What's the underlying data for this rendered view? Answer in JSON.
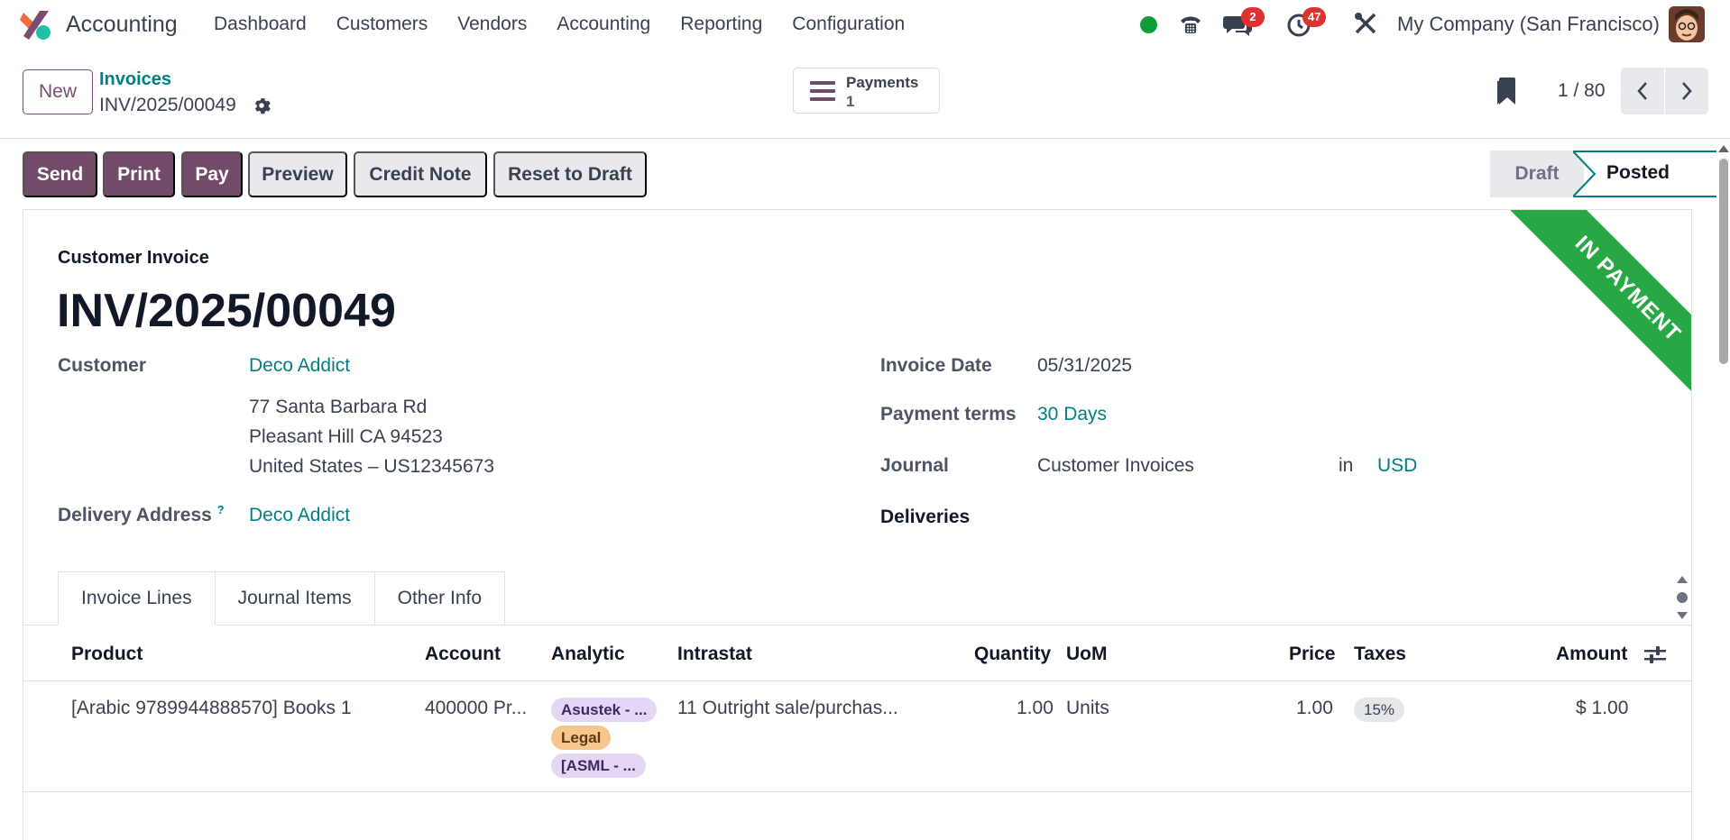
{
  "app": {
    "name": "Accounting",
    "menu": [
      "Dashboard",
      "Customers",
      "Vendors",
      "Accounting",
      "Reporting",
      "Configuration"
    ],
    "company": "My Company (San Francisco)",
    "messages_badge": "2",
    "activities_badge": "47",
    "brand_color": "#714b67",
    "link_color": "#017e84"
  },
  "control_panel": {
    "new_label": "New",
    "breadcrumb_parent": "Invoices",
    "breadcrumb_current": "INV/2025/00049",
    "payments_label": "Payments",
    "payments_count": "1",
    "pager_value": "1 / 80"
  },
  "actions": {
    "send": "Send",
    "print": "Print",
    "pay": "Pay",
    "preview": "Preview",
    "credit_note": "Credit Note",
    "reset_to_draft": "Reset to Draft"
  },
  "status": {
    "draft": "Draft",
    "posted": "Posted"
  },
  "invoice": {
    "ribbon": "IN PAYMENT",
    "type_label": "Customer Invoice",
    "name": "INV/2025/00049",
    "customer_label": "Customer",
    "customer": "Deco Addict",
    "address_line1": "77 Santa Barbara Rd",
    "address_line2": "Pleasant Hill CA 94523",
    "address_line3": "United States – US12345673",
    "delivery_label": "Delivery Address",
    "delivery_help": "?",
    "delivery": "Deco Addict",
    "invoice_date_label": "Invoice Date",
    "invoice_date": "05/31/2025",
    "payment_terms_label": "Payment terms",
    "payment_terms": "30 Days",
    "journal_label": "Journal",
    "journal": "Customer Invoices",
    "journal_in": "in",
    "currency": "USD",
    "deliveries_label": "Deliveries"
  },
  "tabs": [
    "Invoice Lines",
    "Journal Items",
    "Other Info"
  ],
  "lines": {
    "headers": {
      "product": "Product",
      "account": "Account",
      "analytic": "Analytic",
      "intrastat": "Intrastat",
      "quantity": "Quantity",
      "uom": "UoM",
      "price": "Price",
      "taxes": "Taxes",
      "amount": "Amount"
    },
    "rows": [
      {
        "product": "[Arabic 9789944888570] Books 1",
        "account": "400000 Pr...",
        "analytic_tags": [
          "Asustek - ...",
          "Legal",
          "[ASML - ..."
        ],
        "intrastat": "11 Outright sale/purchas...",
        "quantity": "1.00",
        "uom": "Units",
        "price": "1.00",
        "tax": "15%",
        "amount": "$ 1.00"
      }
    ]
  }
}
